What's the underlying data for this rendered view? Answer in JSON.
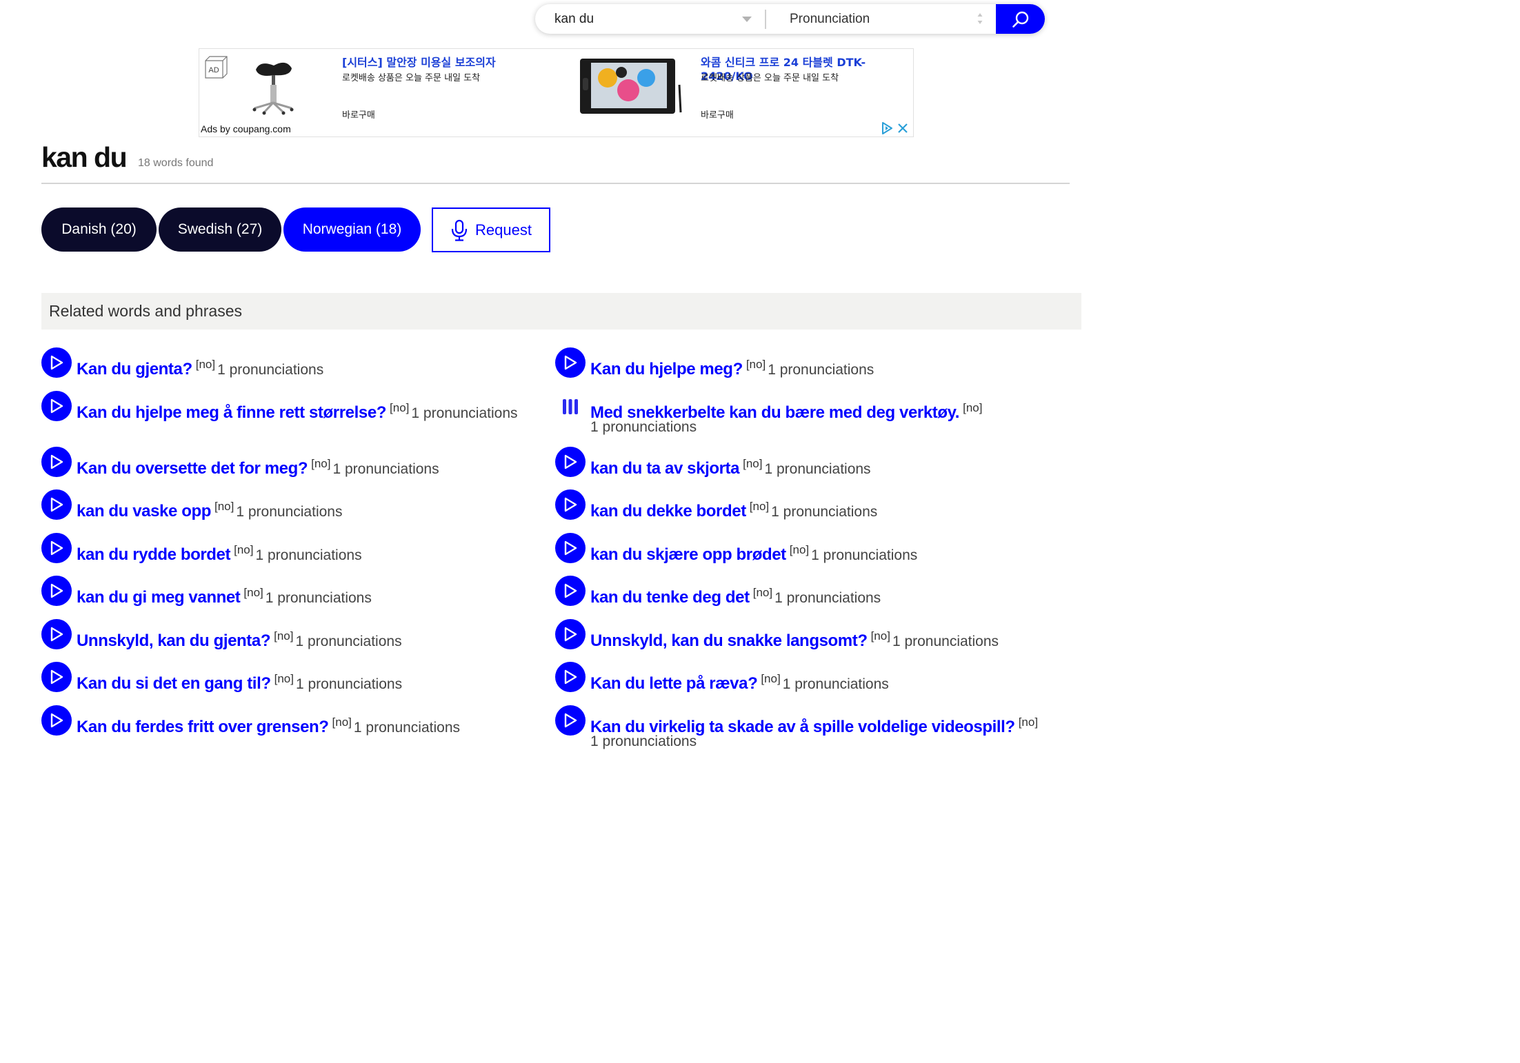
{
  "search": {
    "query": "kan du",
    "type_selected": "Pronunciation"
  },
  "ad": {
    "badge": "AD",
    "product1_title": "[시터스] 말안장 미용실 보조의자",
    "product1_subtitle": "로켓배송 상품은 오늘 주문 내일 도착",
    "product1_buy": "바로구매",
    "product2_title": "와콤 신티크 프로 24 타블렛 DTK-2420/KO",
    "product2_subtitle": "로켓배송 상품은 오늘 주문 내일 도착",
    "product2_buy": "바로구매",
    "ads_by": "Ads by coupang.com"
  },
  "heading": {
    "title": "kan du",
    "count": "18 words found"
  },
  "tabs": [
    {
      "label": "Danish (20)",
      "active": false
    },
    {
      "label": "Swedish (27)",
      "active": false
    },
    {
      "label": "Norwegian (18)",
      "active": true
    }
  ],
  "request_label": "Request",
  "related_title": "Related words and phrases",
  "related_items": [
    {
      "phrase": "Kan du gjenta?",
      "lang": "[no]",
      "count": "1 pronunciations"
    },
    {
      "phrase": "Kan du hjelpe meg?",
      "lang": "[no]",
      "count": "1 pronunciations"
    },
    {
      "phrase": "Kan du hjelpe meg å finne rett størrelse?",
      "lang": "[no]",
      "count": "1 pronunciations"
    },
    {
      "phrase": "Med snekkerbelte kan du bære med deg verktøy.",
      "lang": "[no]",
      "count": "1 pronunciations",
      "playing": true
    },
    {
      "phrase": "Kan du oversette det for meg?",
      "lang": "[no]",
      "count": "1 pronunciations"
    },
    {
      "phrase": "kan du ta av skjorta",
      "lang": "[no]",
      "count": "1 pronunciations"
    },
    {
      "phrase": "kan du vaske opp",
      "lang": "[no]",
      "count": "1 pronunciations"
    },
    {
      "phrase": "kan du dekke bordet",
      "lang": "[no]",
      "count": "1 pronunciations"
    },
    {
      "phrase": "kan du rydde bordet",
      "lang": "[no]",
      "count": "1 pronunciations"
    },
    {
      "phrase": "kan du skjære opp brødet",
      "lang": "[no]",
      "count": "1 pronunciations"
    },
    {
      "phrase": "kan du gi meg vannet",
      "lang": "[no]",
      "count": "1 pronunciations"
    },
    {
      "phrase": "kan du tenke deg det",
      "lang": "[no]",
      "count": "1 pronunciations"
    },
    {
      "phrase": "Unnskyld, kan du gjenta?",
      "lang": "[no]",
      "count": "1 pronunciations"
    },
    {
      "phrase": "Unnskyld, kan du snakke langsomt?",
      "lang": "[no]",
      "count": "1 pronunciations"
    },
    {
      "phrase": "Kan du si det en gang til?",
      "lang": "[no]",
      "count": "1 pronunciations"
    },
    {
      "phrase": "Kan du lette på ræva?",
      "lang": "[no]",
      "count": "1 pronunciations"
    },
    {
      "phrase": "Kan du ferdes fritt over grensen?",
      "lang": "[no]",
      "count": "1 pronunciations"
    },
    {
      "phrase": "Kan du virkelig ta skade av å spille voldelige videospill?",
      "lang": "[no]",
      "count": "1 pronunciations"
    }
  ]
}
